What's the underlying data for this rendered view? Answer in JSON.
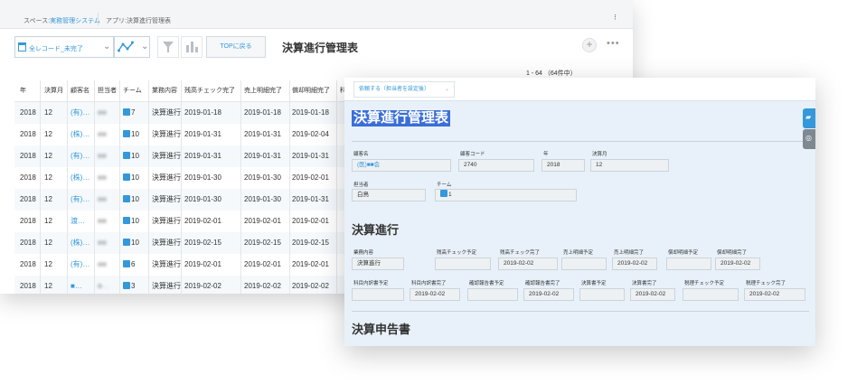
{
  "breadcrumb": {
    "space_prefix": "スペース:",
    "space_name": "実務管理システム",
    "app_prefix": "アプリ:",
    "app_name": "決算進行管理表"
  },
  "toolbar": {
    "view_select": "全レコード_未完了",
    "top_button": "TOPに戻る",
    "app_title": "決算進行管理表",
    "plus": "+",
    "more": "•••",
    "kebab": "⁝"
  },
  "pagination": "1 - 64 （64件中）",
  "list": {
    "columns": [
      "年",
      "決算月",
      "顧客名",
      "担当者",
      "チーム",
      "業務内容",
      "残高チェック完了",
      "売上明細完了",
      "償却明細完了",
      "科"
    ],
    "rows": [
      [
        "2018",
        "12",
        "(有)…",
        "■■",
        "7",
        "決算進行",
        "2019-01-18",
        "2019-01-18",
        "2019-01-18"
      ],
      [
        "2018",
        "12",
        "(株)…",
        "■■",
        "10",
        "決算進行",
        "2019-01-31",
        "2019-01-31",
        "2019-02-04"
      ],
      [
        "2018",
        "12",
        "(有)…",
        "■■",
        "10",
        "決算進行",
        "2019-01-31",
        "2019-01-31",
        "2019-01-31"
      ],
      [
        "2018",
        "12",
        "(株)…",
        "■■",
        "10",
        "決算進行",
        "2019-01-30",
        "2019-01-30",
        "2019-02-01"
      ],
      [
        "2018",
        "12",
        "(有)…",
        "■■",
        "10",
        "決算進行",
        "2019-01-30",
        "2019-01-30",
        "2019-01-31"
      ],
      [
        "2018",
        "12",
        "渡…",
        "■■",
        "10",
        "決算進行",
        "2019-02-01",
        "2019-02-01",
        "2019-02-01"
      ],
      [
        "2018",
        "12",
        "(株)…",
        "■■",
        "10",
        "決算進行",
        "2019-02-15",
        "2019-02-15",
        "2019-02-15"
      ],
      [
        "2018",
        "12",
        "(有)…",
        "■■",
        "6",
        "決算進行",
        "2019-02-01",
        "2019-02-01",
        "2019-02-01"
      ],
      [
        "2018",
        "12",
        "■…",
        "■…",
        "3",
        "決算進行",
        "2019-02-02",
        "2019-02-02",
        "2019-02-02"
      ]
    ]
  },
  "detail": {
    "assign_button": "依頼する（担当者を設定後）",
    "form_title": "決算進行管理表",
    "customer_label": "顧客名",
    "customer_value": "(医)■■会",
    "customer_code_label": "顧客コード",
    "customer_code_value": "2740",
    "year_label": "年",
    "year_value": "2018",
    "month_label": "決算月",
    "month_value": "12",
    "staff_label": "担当者",
    "staff_value": "白鳥",
    "team_label": "チーム",
    "team_value": "1",
    "section1": "決算進行",
    "section2": "決算申告書",
    "fields_row1": [
      {
        "label": "業務内容",
        "value": "決算進行"
      },
      {
        "label": "残高チェック予定",
        "value": ""
      },
      {
        "label": "残高チェック完了",
        "value": "2019-02-02"
      },
      {
        "label": "売上明細予定",
        "value": ""
      },
      {
        "label": "売上明細完了",
        "value": "2019-02-02"
      },
      {
        "label": "償却明細予定",
        "value": ""
      },
      {
        "label": "償却明細完了",
        "value": "2019-02-02"
      }
    ],
    "fields_row2": [
      {
        "label": "科目内訳書予定",
        "value": ""
      },
      {
        "label": "科目内訳書完了",
        "value": "2019-02-02"
      },
      {
        "label": "確認報告書予定",
        "value": ""
      },
      {
        "label": "確認報告書完了",
        "value": "2019-02-02"
      },
      {
        "label": "決算書予定",
        "value": ""
      },
      {
        "label": "決算書完了",
        "value": "2019-02-02"
      },
      {
        "label": "税理チェック予定",
        "value": ""
      },
      {
        "label": "税理チェック完了",
        "value": "2019-02-02"
      }
    ]
  }
}
